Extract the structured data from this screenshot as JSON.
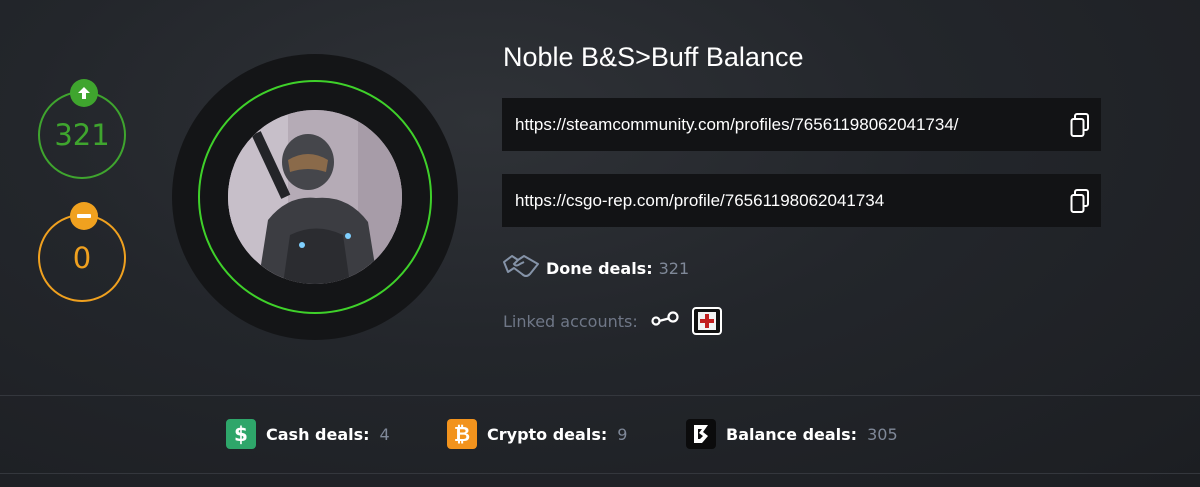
{
  "reputation": {
    "positive": "321",
    "negative": "0"
  },
  "profile": {
    "name": "Noble B&S>Buff Balance",
    "steam_url": "https://steamcommunity.com/profiles/76561198062041734/",
    "rep_url": "https://csgo-rep.com/profile/76561198062041734",
    "done_deals_label": "Done deals:",
    "done_deals_value": "321",
    "linked_accounts_label": "Linked accounts:",
    "linked_accounts": [
      "steam-icon",
      "csgo-rep-icon"
    ]
  },
  "deals": {
    "cash_label": "Cash deals:",
    "cash_value": "4",
    "crypto_label": "Crypto deals:",
    "crypto_value": "9",
    "balance_label": "Balance deals:",
    "balance_value": "305"
  },
  "colors": {
    "positive": "#3fa52e",
    "negative": "#f0a11f",
    "avatar_ring": "#3fd12a",
    "cash": "#2ea66a",
    "crypto": "#f2931d",
    "balance": "#0b0b0c"
  }
}
